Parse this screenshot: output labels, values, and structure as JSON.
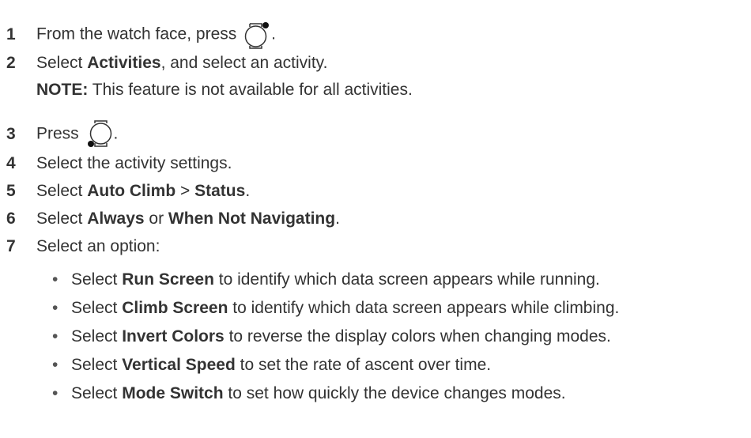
{
  "steps": [
    {
      "num": "1",
      "text_before": "From the watch face, press ",
      "icon": "watch-button-top-right-icon",
      "text_after": "."
    },
    {
      "num": "2",
      "parts": [
        "Select ",
        "Activities",
        ", and select an activity."
      ]
    },
    {
      "note_label": "NOTE:",
      "note_text": " This feature is not available for all activities."
    },
    {
      "num": "3",
      "text_before": "Press ",
      "icon": "watch-button-bottom-left-icon",
      "text_after": "."
    },
    {
      "num": "4",
      "text": "Select the activity settings."
    },
    {
      "num": "5",
      "parts": [
        "Select ",
        "Auto Climb",
        " > ",
        "Status",
        "."
      ]
    },
    {
      "num": "6",
      "parts": [
        "Select ",
        "Always",
        " or ",
        "When Not Navigating",
        "."
      ]
    },
    {
      "num": "7",
      "text": "Select an option:"
    }
  ],
  "bullets": [
    {
      "dot": "•",
      "pre": "Select ",
      "bold": "Run Screen",
      "post": " to identify which data screen appears while running."
    },
    {
      "dot": "•",
      "pre": "Select ",
      "bold": "Climb Screen",
      "post": " to identify which data screen appears while climbing."
    },
    {
      "dot": "•",
      "pre": "Select ",
      "bold": "Invert Colors",
      "post": " to reverse the display colors when changing modes."
    },
    {
      "dot": "•",
      "pre": "Select ",
      "bold": "Vertical Speed",
      "post": " to set the rate of ascent over time."
    },
    {
      "dot": "•",
      "pre": "Select ",
      "bold": "Mode Switch",
      "post": " to set how quickly the device changes modes."
    }
  ]
}
